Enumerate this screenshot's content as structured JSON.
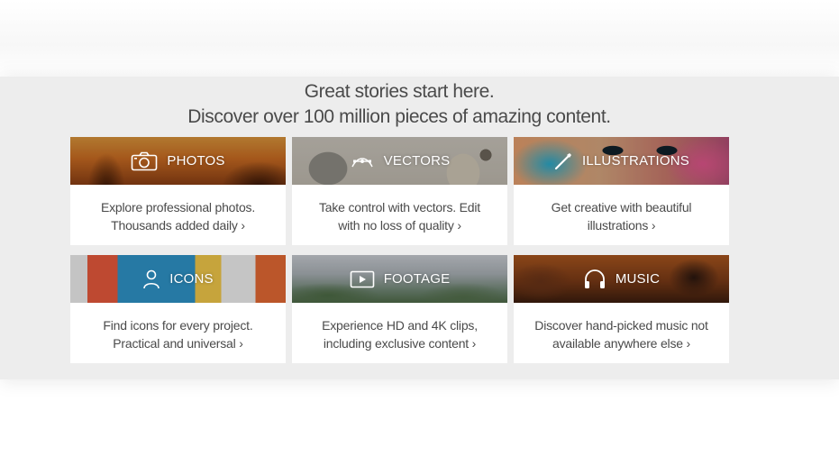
{
  "headline": {
    "line1": "Great stories start here.",
    "line2": "Discover over 100 million pieces of amazing content."
  },
  "categories": [
    {
      "title": "PHOTOS",
      "icon": "camera-icon",
      "desc_line1": "Explore professional photos.",
      "desc_line2": "Thousands added daily ›"
    },
    {
      "title": "VECTORS",
      "icon": "pen-tool-icon",
      "desc_line1": "Take control with vectors. Edit",
      "desc_line2": "with no loss of quality ›"
    },
    {
      "title": "ILLUSTRATIONS",
      "icon": "paintbrush-icon",
      "desc_line1": "Get creative with beautiful",
      "desc_line2": "illustrations ›"
    },
    {
      "title": "ICONS",
      "icon": "person-icon",
      "desc_line1": "Find icons for every project.",
      "desc_line2": "Practical and universal ›"
    },
    {
      "title": "FOOTAGE",
      "icon": "play-icon",
      "desc_line1": "Experience HD and 4K clips,",
      "desc_line2": "including exclusive content ›"
    },
    {
      "title": "MUSIC",
      "icon": "headphones-icon",
      "desc_line1": "Discover hand-picked music not",
      "desc_line2": "available anywhere else ›"
    }
  ],
  "colors": {
    "band_background": "#ededed",
    "text": "#4a4a4a",
    "card_background": "#ffffff"
  }
}
